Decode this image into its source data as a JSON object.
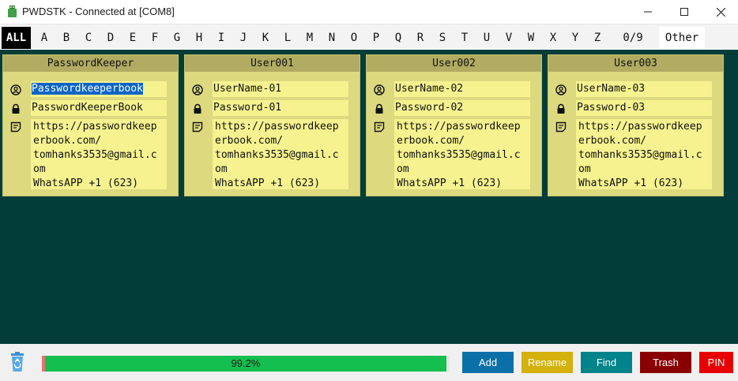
{
  "window": {
    "title": "PWDSTK - Connected at [COM8]"
  },
  "letterbar": {
    "items": [
      "ALL",
      "A",
      "B",
      "C",
      "D",
      "E",
      "F",
      "G",
      "H",
      "I",
      "J",
      "K",
      "L",
      "M",
      "N",
      "O",
      "P",
      "Q",
      "R",
      "S",
      "T",
      "U",
      "V",
      "W",
      "X",
      "Y",
      "Z",
      "0/9",
      "Other"
    ],
    "active": "ALL"
  },
  "cards": [
    {
      "title": "PasswordKeeper",
      "username": "Passwordkeeperbook",
      "password": "PasswordKeeperBook",
      "note": "https://passwordkeep\nerbook.com/\ntomhanks3535@gmail.c\nom\nWhatsAPP +1 (623)"
    },
    {
      "title": "User001",
      "username": "UserName-01",
      "password": "Password-01",
      "note": "https://passwordkeep\nerbook.com/\ntomhanks3535@gmail.c\nom\nWhatsAPP +1 (623)"
    },
    {
      "title": "User002",
      "username": "UserName-02",
      "password": "Password-02",
      "note": "https://passwordkeep\nerbook.com/\ntomhanks3535@gmail.c\nom\nWhatsAPP +1 (623)"
    },
    {
      "title": "User003",
      "username": "UserName-03",
      "password": "Password-03",
      "note": "https://passwordkeep\nerbook.com/\ntomhanks3535@gmail.c\nom\nWhatsAPP +1 (623)"
    }
  ],
  "progress": {
    "label": "99.2%",
    "value": 99.2,
    "fill_color": "#14bf4f"
  },
  "buttons": {
    "add": "Add",
    "rename": "Rename",
    "find": "Find",
    "trash": "Trash",
    "pin": "PIN"
  },
  "colors": {
    "main_bg": "#023d3a",
    "card_bg": "#dcd97f",
    "card_header": "#b2ac62",
    "field_bg": "#f6f28f",
    "add": "#0b70a8",
    "rename": "#d4b10b",
    "find": "#00838a",
    "trash": "#8a0000",
    "pin": "#e80000"
  },
  "icons": {
    "app": "usb-stick-icon",
    "user": "user-circle-icon",
    "password": "lock-icon",
    "note": "note-icon",
    "recycle": "recycle-bin-icon"
  }
}
